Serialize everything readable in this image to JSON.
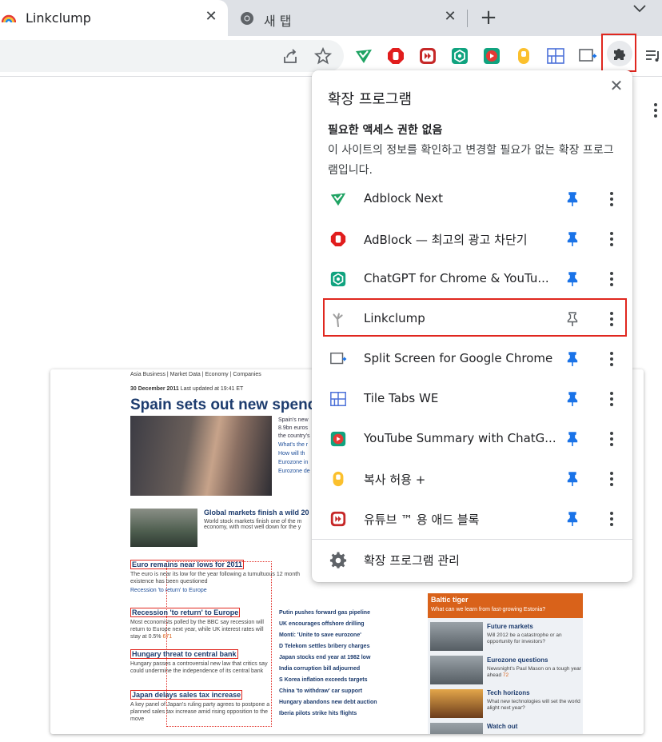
{
  "tabs": [
    {
      "title": "Linkclump",
      "active": true
    },
    {
      "title": "새 탭",
      "active": false
    }
  ],
  "extensions_panel": {
    "title": "확장 프로그램",
    "section_heading": "필요한 액세스 권한 없음",
    "section_description": "이 사이트의 정보를 확인하고 변경할 필요가 없는 확장 프로그램입니다.",
    "items": [
      {
        "name": "Adblock Next",
        "icon": "adblock-next-icon",
        "pinned": true
      },
      {
        "name": "AdBlock — 최고의 광고 차단기",
        "icon": "adblock-hand-icon",
        "pinned": true
      },
      {
        "name": "ChatGPT for Chrome & YouTu...",
        "icon": "chatgpt-icon",
        "pinned": true
      },
      {
        "name": "Linkclump",
        "icon": "linkclump-icon",
        "pinned": false
      },
      {
        "name": "Split Screen for Google Chrome",
        "icon": "split-screen-icon",
        "pinned": true
      },
      {
        "name": "Tile Tabs WE",
        "icon": "tile-tabs-icon",
        "pinned": true
      },
      {
        "name": "YouTube Summary with ChatG...",
        "icon": "youtube-summary-icon",
        "pinned": true
      },
      {
        "name": "복사 허용 +",
        "icon": "copy-allow-icon",
        "pinned": true
      },
      {
        "name": "유튜브 ™ 용 애드 블록",
        "icon": "youtube-adblock-icon",
        "pinned": true
      }
    ],
    "manage_label": "확장 프로그램 관리"
  },
  "colors": {
    "highlight": "#e0271f",
    "pin_active": "#1a73e8",
    "pin_inactive": "#5f6368"
  },
  "screenshot": {
    "nav": "Asia Business  |  Market Data  |  Economy  |  Companies",
    "date": "30 December 2011",
    "updated": "Last updated at 19:41 ET",
    "headline": "Spain sets out new spendin",
    "side_text": [
      "Spain's new",
      "8.9bn euros",
      "the country's"
    ],
    "side_links": [
      "What's the r",
      "How will th",
      "Eurozone in",
      "Eurozone de"
    ],
    "global_markets_title": "Global markets finish a wild 20",
    "global_markets_body": "World stock markets finish one of the m economy, with most well down for the y",
    "stories": [
      {
        "title": "Euro remains near lows for 2011",
        "body": "The euro is near its low for the year following a tumultuous 12 month existence has been questioned",
        "link": "Recession 'to return' to Europe"
      },
      {
        "title": "Recession 'to return' to Europe",
        "body": "Most economists polled by the BBC say recession will return to Europe next year, while UK interest rates will stay at 0.5%",
        "count": "671"
      },
      {
        "title": "Hungary threat to central bank",
        "body": "Hungary passes a controversial new law that critics say could undermine the independence of its central bank"
      },
      {
        "title": "Japan delays sales tax increase",
        "body": "A key panel of Japan's ruling party agrees to postpone a planned sales tax increase amid rising opposition to the move"
      }
    ],
    "mid_links": [
      "Putin pushes forward gas pipeline",
      "UK encourages offshore drilling",
      "Monti: 'Unite to save eurozone'",
      "D Telekom settles bribery charges",
      "Japan stocks end year at 1982 low",
      "India corruption bill adjourned",
      "S Korea inflation exceeds targets",
      "China 'to withdraw' car support",
      "Hungary abandons new debt auction",
      "Iberia pilots strike hits flights"
    ],
    "baltic_title": "Baltic tiger",
    "baltic_sub": "What can we learn from fast-growing Estonia?",
    "right_items": [
      {
        "title": "Future markets",
        "body": "Will 2012 be a catastrophe or an opportunity for investors?"
      },
      {
        "title": "Eurozone questions",
        "body": "Newsnight's Paul Mason on a tough year ahead",
        "count": "72"
      },
      {
        "title": "Tech horizons",
        "body": "What new technologies will set the world alight next year?"
      },
      {
        "title": "Watch out",
        "body": ""
      }
    ]
  }
}
